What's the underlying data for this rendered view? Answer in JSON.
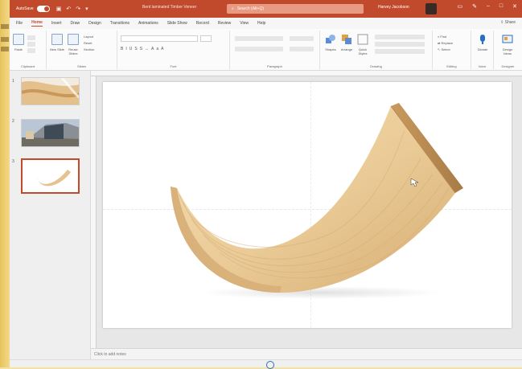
{
  "titlebar": {
    "autosave_label": "AutoSave",
    "doc_title": "Bent laminated Timber Veneer",
    "search_placeholder": "Search (Alt+Q)",
    "user_name": "Harvey Jacobson"
  },
  "tabs": [
    "File",
    "Home",
    "Insert",
    "Draw",
    "Design",
    "Transitions",
    "Animations",
    "Slide Show",
    "Record",
    "Review",
    "View",
    "Help"
  ],
  "active_tab": "Home",
  "share_label": "Share",
  "ribbon": {
    "groups": [
      {
        "id": "clipboard",
        "label": "Clipboard"
      },
      {
        "id": "slides",
        "label": "Slides"
      },
      {
        "id": "font",
        "label": "Font"
      },
      {
        "id": "paragraph",
        "label": "Paragraph"
      },
      {
        "id": "drawing",
        "label": "Drawing"
      },
      {
        "id": "editing",
        "label": "Editing"
      },
      {
        "id": "voice",
        "label": "Voice"
      },
      {
        "id": "designer",
        "label": "Designer"
      }
    ],
    "buttons": {
      "paste": "Paste",
      "new_slide": "New Slide",
      "reuse_slides": "Reuse Slides",
      "layout": "Layout",
      "reset": "Reset",
      "section": "Section",
      "shapes": "Shapes",
      "arrange": "Arrange",
      "quick_styles": "Quick Styles",
      "find": "Find",
      "replace": "Replace",
      "select": "Select",
      "dictate": "Dictate",
      "design_ideas": "Design Ideas"
    }
  },
  "slides": [
    {
      "number": "1"
    },
    {
      "number": "2"
    },
    {
      "number": "3"
    }
  ],
  "active_slide": 3,
  "notes_placeholder": "Click to add notes",
  "colors": {
    "accent": "#c24a2c",
    "wood_light": "#f2dab0",
    "wood_mid": "#e3bf88",
    "wood_dark": "#c69a5c"
  }
}
